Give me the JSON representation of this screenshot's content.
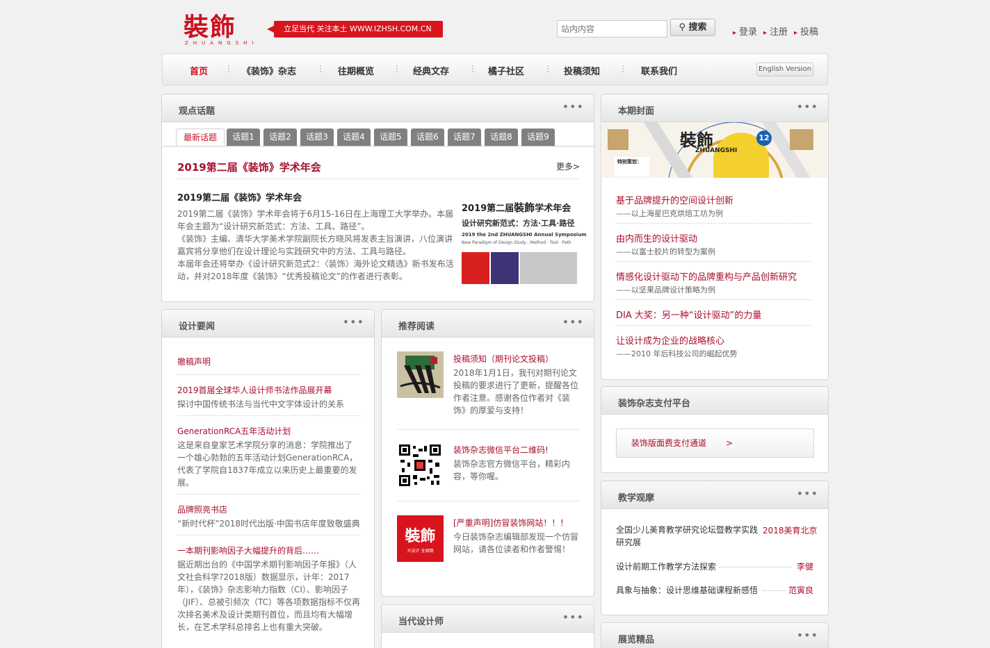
{
  "header": {
    "logo_cn": "裝飾",
    "logo_en": "ZHUANGSHI",
    "slogan": "立足当代  关注本土   WWW.IZHSH.COM.CN",
    "search_placeholder": "站内内容",
    "search_label": "搜索",
    "links": [
      "登录",
      "注册",
      "投稿"
    ]
  },
  "nav": {
    "items": [
      "首页",
      "《装饰》杂志",
      "往期概览",
      "经典文存",
      "橘子社区",
      "投稿须知",
      "联系我们"
    ],
    "english": "English Version"
  },
  "topic": {
    "title": "观点话题",
    "tabs": [
      "最新话题",
      "话题1",
      "话题2",
      "话题3",
      "话题4",
      "话题5",
      "话题6",
      "话题7",
      "话题8",
      "话题9"
    ],
    "headline": "2019第二届《装饰》学术年会",
    "more": "更多>",
    "subtitle": "2019第二届《装饰》学术年会",
    "body": "2019第二届《装饰》学术年会将于6月15-16日在上海理工大学举办。本届年会主题为“设计研究新范式：方法、工具、路径”。\n《装饰》主编、清华大学美术学院副院长方晓风将发表主旨演讲，八位演讲嘉宾将分享他们在设计理论与实践研究中的方法、工具与路径。\n本届年会还将举办《设计研究新范式2：〈装饰〉海外论文精选》新书发布活动，并对2018年度《装饰》“优秀投稿论文”的作者进行表彰。",
    "poster": {
      "l1a": "2019第二届",
      "l1b": "裝飾",
      "l1c": "学术年会",
      "l2": "设计研究新范式：方法·工具·路径",
      "l3": "2019 the 2nd ZHUANGSHI Annual Symposium",
      "l4": "New Paradigm of Design Study : Method · Tool · Path"
    },
    "poster_colors": [
      "#d8201e",
      "#3d3477",
      "#c8c8c8"
    ]
  },
  "cover": {
    "title": "本期封面",
    "cover_logo": "裝飾",
    "cover_issue": "12",
    "cover_en": "ZHUANGSHI",
    "cover_feature": "特别策划：",
    "items": [
      {
        "t": "基于品牌提升的空间设计创新",
        "s": "——以上海星巴克烘焙工坊为例"
      },
      {
        "t": "由内而生的设计驱动",
        "s": "——以富士胶片的转型为案例"
      },
      {
        "t": "情感化设计驱动下的品牌重构与产品创新研究",
        "s": "——以坚果品牌设计策略为例"
      },
      {
        "t": "DIA 大奖：另一种“设计驱动”的力量",
        "s": ""
      },
      {
        "t": "让设计成为企业的战略核心",
        "s": "——2010 年后科技公司的崛起优势"
      }
    ]
  },
  "news": {
    "title": "设计要闻",
    "items": [
      {
        "t": "撤稿声明",
        "s": ""
      },
      {
        "t": "2019首届全球华人设计师书法作品展开幕",
        "s": "探讨中国传统书法与当代中文字体设计的关系"
      },
      {
        "t": "GenerationRCA五年活动计划",
        "s": "这是来自皇家艺术学院分享的消息：学院推出了一个雄心勃勃的五年活动计划GenerationRCA，代表了学院自1837年成立以来历史上最重要的发展。"
      },
      {
        "t": "品牌照亮书店",
        "s": "“新时代杯”2018时代出版·中国书店年度致敬盛典"
      },
      {
        "t": "一本期刊影响因子大幅提升的背后……",
        "s": "据近期出台的《中国学术期刊影响因子年报》（人文社会科学?2018版）数据显示，计年：2017年），《装饰》杂志影响力指数（CI）、影响因子（JIF）、总被引频次（TC）等各项数据指标不仅再次排名美术及设计类期刊首位，而且均有大幅增长，在艺术学科总排名上也有重大突破。"
      }
    ]
  },
  "recommend": {
    "title": "推荐阅读",
    "items": [
      {
        "t": "投稿须知（期刊论文投稿）",
        "s": "2018年1月1日，我刊对期刊论文投稿的要求进行了更新，提醒各位作者注意。感谢各位作者对《装饰》的厚爱与支持！"
      },
      {
        "t": "装饰杂志微信平台二维码!",
        "s": "装饰杂志官方微信平台，精彩内容，等你喔。"
      },
      {
        "t": "[严重声明]仿冒装饰网站！！！",
        "s": "今日装饰杂志编辑部发现一个仿冒网站，请各位读者和作者警惕！"
      }
    ],
    "thumb_logo": "裝飾",
    "thumb_sub": "大设计 全周期"
  },
  "designer": {
    "title": "当代设计师"
  },
  "pay": {
    "title": "装饰杂志支付平台",
    "link": "装饰版面费支付通道",
    "arrow": ">"
  },
  "teach": {
    "title": "教学观摩",
    "items": [
      {
        "t": "全国少儿美育教学研究论坛暨教学实践研究展",
        "a": "2018美育北京"
      },
      {
        "t": "设计前期工作教学方法探索",
        "a": "李健"
      },
      {
        "t": "具象与抽象：设计思维基础课程新感悟",
        "a": "范寅良"
      }
    ]
  },
  "exhibit": {
    "title": "展览精品"
  }
}
